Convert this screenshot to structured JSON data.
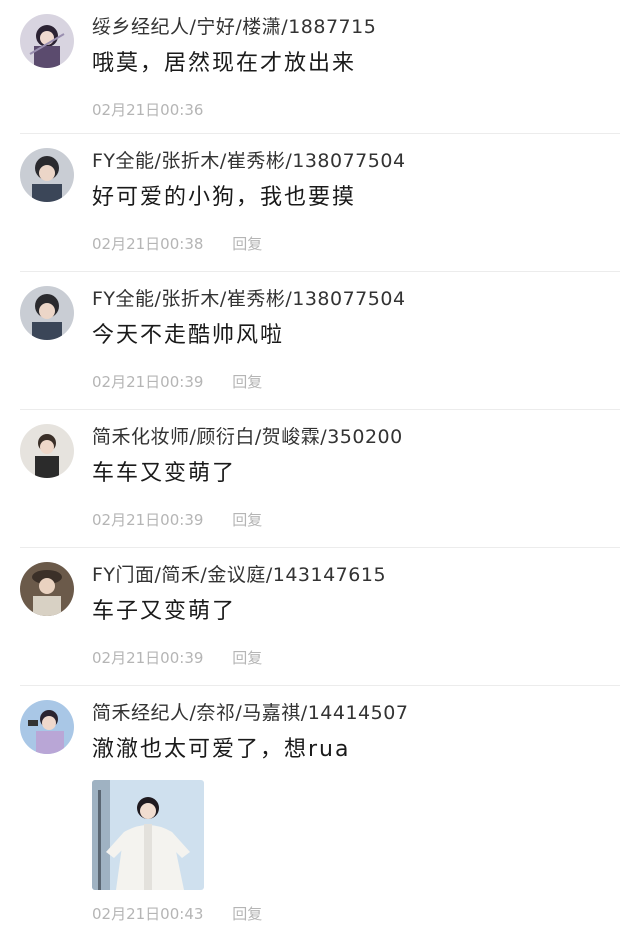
{
  "comments": [
    {
      "author": "绥乡经纪人/宁好/楼潇/1887715",
      "text": "哦莫，居然现在才放出来",
      "time": "02月21日00:36",
      "reply_label": "",
      "avatar": "avatar-1"
    },
    {
      "author": "FY全能/张折木/崔秀彬/138077504",
      "text": "好可爱的小狗，我也要摸",
      "time": "02月21日00:38",
      "reply_label": "回复",
      "avatar": "avatar-2"
    },
    {
      "author": "FY全能/张折木/崔秀彬/138077504",
      "text": "今天不走酷帅风啦",
      "time": "02月21日00:39",
      "reply_label": "回复",
      "avatar": "avatar-3"
    },
    {
      "author": "简禾化妆师/顾衍白/贺峻霖/350200",
      "text": "车车又变萌了",
      "time": "02月21日00:39",
      "reply_label": "回复",
      "avatar": "avatar-4"
    },
    {
      "author": "FY门面/简禾/金议庭/143147615",
      "text": "车子又变萌了",
      "time": "02月21日00:39",
      "reply_label": "回复",
      "avatar": "avatar-5"
    },
    {
      "author": "简禾经纪人/奈祁/马嘉祺/14414507",
      "text": "澈澈也太可爱了，想rua",
      "time": "02月21日00:43",
      "reply_label": "回复",
      "avatar": "avatar-6"
    }
  ]
}
